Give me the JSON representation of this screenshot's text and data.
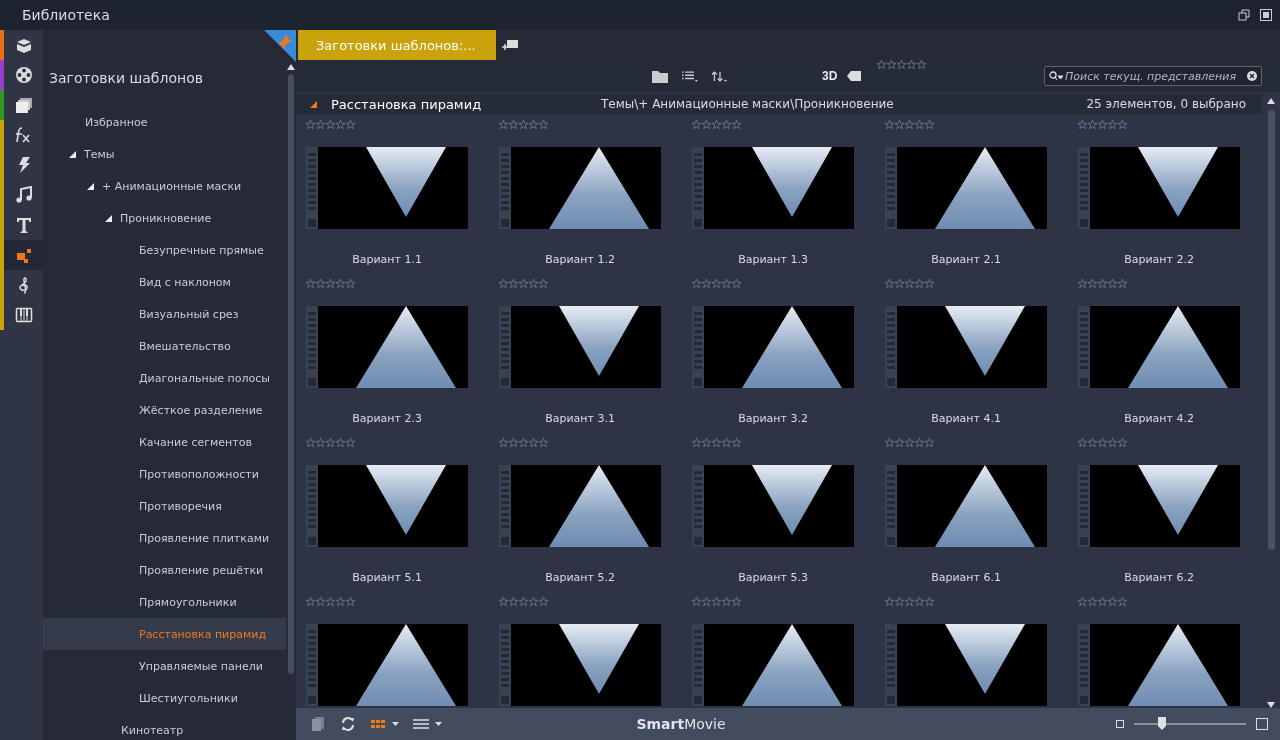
{
  "window": {
    "title": "Библиотека"
  },
  "rail": [
    {
      "color": "#e8701a",
      "selected": false
    },
    {
      "color": "#9b3fc9",
      "selected": false
    },
    {
      "color": "#2f9a1e",
      "selected": false
    },
    {
      "color": "#c9a20c",
      "selected": false
    },
    {
      "color": "#c9a20c",
      "selected": false
    },
    {
      "color": "#c9a20c",
      "selected": false
    },
    {
      "color": "#c9a20c",
      "selected": false
    },
    {
      "color": "#c9a20c",
      "selected": true
    },
    {
      "color": "#c9a20c",
      "selected": false
    },
    {
      "color": "#c9a20c",
      "selected": false
    }
  ],
  "sidebar": {
    "heading": "Заготовки шаблонов",
    "tree": [
      {
        "label": "Избранное",
        "selected": false
      },
      {
        "label": "Темы",
        "expanded": true,
        "selected": false,
        "children": [
          {
            "label": "+ Анимационные маски",
            "expanded": true,
            "selected": false,
            "children": [
              {
                "label": "Проникновение",
                "expanded": true,
                "selected": false,
                "children": [
                  {
                    "label": "Безупречные прямые",
                    "selected": false
                  },
                  {
                    "label": "Вид с наклоном",
                    "selected": false
                  },
                  {
                    "label": "Визуальный срез",
                    "selected": false
                  },
                  {
                    "label": "Вмешательство",
                    "selected": false
                  },
                  {
                    "label": "Диагональные полосы",
                    "selected": false
                  },
                  {
                    "label": "Жёсткое разделение",
                    "selected": false
                  },
                  {
                    "label": "Качание сегментов",
                    "selected": false
                  },
                  {
                    "label": "Противоположности",
                    "selected": false
                  },
                  {
                    "label": "Противоречия",
                    "selected": false
                  },
                  {
                    "label": "Проявление плитками",
                    "selected": false
                  },
                  {
                    "label": "Проявление решётки",
                    "selected": false
                  },
                  {
                    "label": "Прямоугольники",
                    "selected": false
                  },
                  {
                    "label": "Расстановка пирамид",
                    "selected": true
                  },
                  {
                    "label": "Управляемые панели",
                    "selected": false
                  },
                  {
                    "label": "Шестиугольники",
                    "selected": false
                  }
                ]
              },
              {
                "label": "Кинотеатр",
                "selected": false
              }
            ]
          }
        ]
      }
    ]
  },
  "tabs": [
    {
      "label": "Заготовки шаблонов:...",
      "selected": true
    }
  ],
  "toolbar": {
    "view_3d": "3D",
    "stars": 0,
    "search": {
      "placeholder": "Поиск текущ. представления"
    }
  },
  "header": {
    "title": "Расстановка пирамид",
    "path": "Темы\\+ Анимационные маски\\Проникновение",
    "count": "25 элементов, 0 выбрано"
  },
  "items": [
    {
      "label": "Вариант 1.1",
      "stars": 0
    },
    {
      "label": "Вариант 1.2",
      "stars": 0
    },
    {
      "label": "Вариант 1.3",
      "stars": 0
    },
    {
      "label": "Вариант 2.1",
      "stars": 0
    },
    {
      "label": "Вариант 2.2",
      "stars": 0
    },
    {
      "label": "Вариант 2.3",
      "stars": 0
    },
    {
      "label": "Вариант 3.1",
      "stars": 0
    },
    {
      "label": "Вариант 3.2",
      "stars": 0
    },
    {
      "label": "Вариант 4.1",
      "stars": 0
    },
    {
      "label": "Вариант 4.2",
      "stars": 0
    },
    {
      "label": "Вариант 5.1",
      "stars": 0
    },
    {
      "label": "Вариант 5.2",
      "stars": 0
    },
    {
      "label": "Вариант 5.3",
      "stars": 0
    },
    {
      "label": "Вариант 6.1",
      "stars": 0
    },
    {
      "label": "Вариант 6.2",
      "stars": 0
    },
    {
      "stars": 0
    },
    {
      "stars": 0
    },
    {
      "stars": 0
    },
    {
      "stars": 0
    },
    {
      "stars": 0
    }
  ],
  "bottom_bar": {
    "brand": "**Smart**Movie",
    "zoom": {
      "level": 0.25
    }
  }
}
